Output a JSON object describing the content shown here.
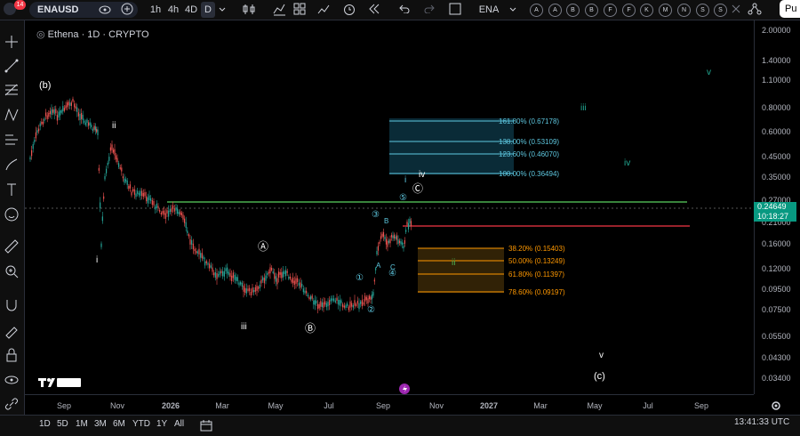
{
  "notification_count": "14",
  "symbol": "ENAUSD",
  "timeframes": [
    "1h",
    "4h",
    "4D",
    "D"
  ],
  "active_timeframe": "D",
  "ticker_short": "ENA",
  "letter_buttons": [
    "A",
    "A",
    "B",
    "B",
    "F",
    "F",
    "K",
    "M",
    "N",
    "S",
    "S"
  ],
  "publish_label": "Pu",
  "chart_title": "Ethena · 1D · CRYPTO",
  "price_axis": [
    "2.00000",
    "1.40000",
    "1.10000",
    "0.80000",
    "0.60000",
    "0.45000",
    "0.35000",
    "0.27000",
    "0.21000",
    "0.16000",
    "0.12000",
    "0.09500",
    "0.07500",
    "0.05500",
    "0.04300",
    "0.03400"
  ],
  "current_price": {
    "value": "0.24649",
    "countdown": "10:18:27",
    "color": "#089981"
  },
  "time_axis": [
    "Sep",
    "Nov",
    "2026",
    "Mar",
    "May",
    "Jul",
    "Sep",
    "Nov",
    "2027",
    "Mar",
    "May",
    "Jul",
    "Sep"
  ],
  "fib_ext": [
    {
      "label": "161.80% (0.67178)"
    },
    {
      "label": "138.00% (0.53109)"
    },
    {
      "label": "123.60% (0.46070)"
    },
    {
      "label": "100.00% (0.36494)"
    }
  ],
  "fib_ret": [
    {
      "label": "38.20% (0.15403)"
    },
    {
      "label": "50.00% (0.13249)"
    },
    {
      "label": "61.80% (0.11397)"
    },
    {
      "label": "78.60% (0.09197)"
    }
  ],
  "wave_labels": {
    "b": "(b)",
    "ii": "ii",
    "i": "i",
    "A": "Ⓐ",
    "iii": "iii",
    "B": "Ⓑ",
    "C": "Ⓒ",
    "iv": "iv",
    "c": "(c)",
    "w1": "①",
    "w2": "②",
    "w3": "③",
    "w4": "④",
    "w5": "⑤",
    "sA": "A",
    "sB": "B",
    "sC": "C",
    "ii_g": "ii",
    "iii_t": "iii",
    "iv_t": "iv",
    "v_t": "v",
    "i_t": "i",
    "v_w": "v"
  },
  "bottom_ranges": [
    "1D",
    "5D",
    "1M",
    "3M",
    "6M",
    "YTD",
    "1Y",
    "All"
  ],
  "clock": "13:41:33 UTC",
  "colors": {
    "support": "#4caf50",
    "resistance": "#f23645",
    "fib_ext": "#5ec8e0",
    "fib_ret": "#ff9800",
    "up": "#26a69a",
    "down": "#ef5350",
    "teal": "#22ab94"
  }
}
